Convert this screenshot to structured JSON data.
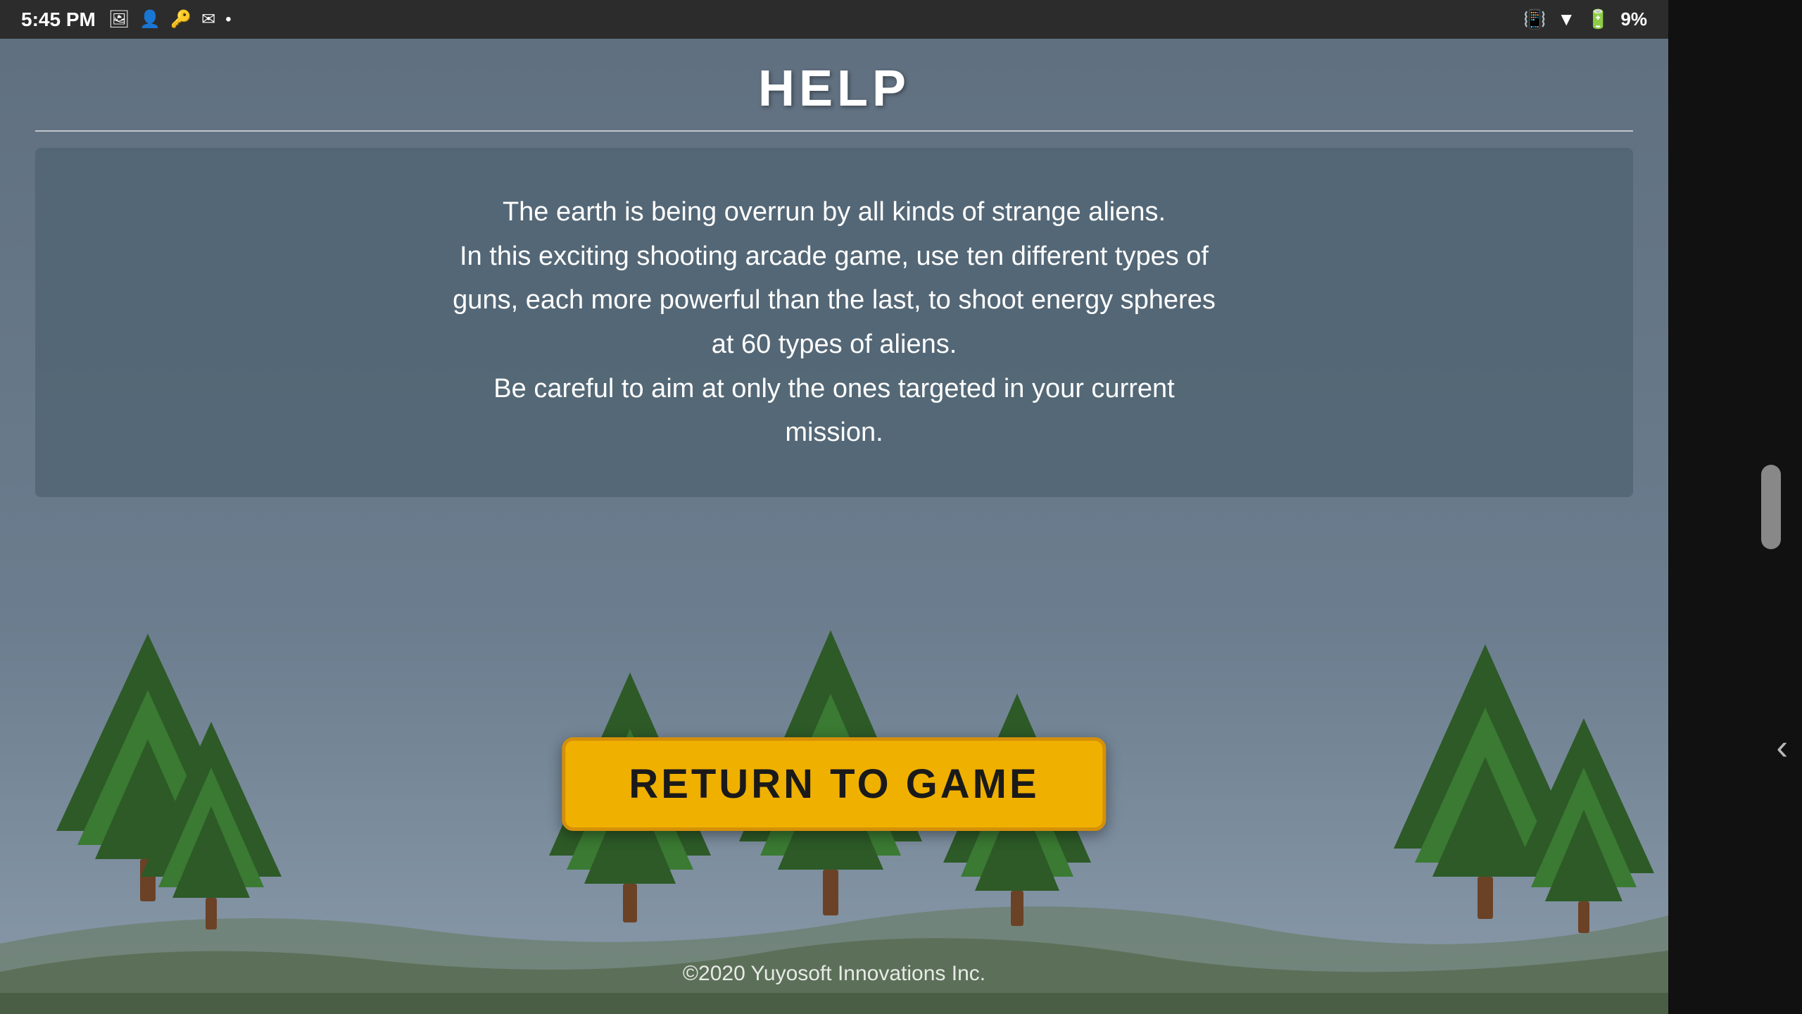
{
  "statusBar": {
    "time": "5:45 PM",
    "batteryPercent": "9%",
    "icons": [
      "image-icon",
      "person-icon",
      "key-icon",
      "mail-icon",
      "dot-icon"
    ]
  },
  "page": {
    "title": "HELP",
    "dividerVisible": true
  },
  "helpText": {
    "line1": "The earth is being overrun by all kinds of strange aliens.",
    "line2": "In this exciting shooting arcade game, use ten different types of",
    "line3": "guns, each more powerful than the last, to shoot energy spheres",
    "line4": "at 60 types of aliens.",
    "line5": "Be careful to aim at only the ones targeted in your current",
    "line6": "mission."
  },
  "returnButton": {
    "label": "RETURN TO GAME"
  },
  "footer": {
    "text": "©2020 Yuyosoft Innovations Inc."
  },
  "colors": {
    "background": "#5a6a78",
    "statusBarBg": "#2c2c2c",
    "helpBoxBg": "rgba(80, 100, 115, 0.82)",
    "buttonBg": "#f0b000",
    "buttonBorder": "#d4900a",
    "treeDark": "#2d5a27",
    "treeMid": "#3a7a32",
    "treeTrunk": "#6b4226",
    "ground": "#7a8a70"
  }
}
